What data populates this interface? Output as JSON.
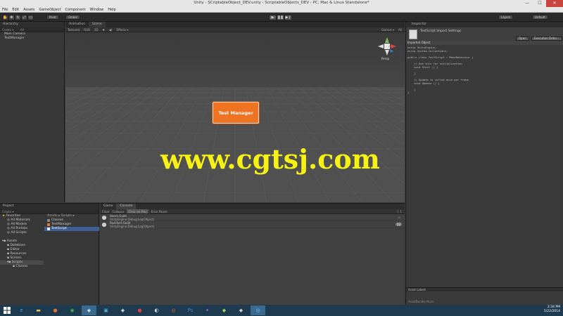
{
  "window": {
    "title": "Unity - SCriptableObject_DEV.unity - ScriptableObjects_DEV - PC, Mac & Linux Standalone*",
    "min": "—",
    "max": "☐",
    "close": "✕"
  },
  "menu": [
    "File",
    "Edit",
    "Assets",
    "GameObject",
    "Component",
    "Window",
    "Help"
  ],
  "toolbar": {
    "pivot": "Pivot",
    "global": "Global",
    "layers": "Layers",
    "layout": "Default"
  },
  "hierarchy": {
    "tab": "Hierarchy",
    "create": "Create ▾",
    "search": "All",
    "items": [
      "Main Camera",
      "TestManager"
    ]
  },
  "scene": {
    "tabs": [
      "Animation",
      "Scene"
    ],
    "bar_items": [
      "Textured",
      "RGB",
      "2D",
      "✹",
      "◀)",
      "Effects ▾"
    ],
    "bar_right": [
      "Gizmos ▾",
      "All"
    ],
    "gizmo_label": "Persp",
    "ui_button": "Test Manager",
    "watermark": "www.cgtsj.com"
  },
  "inspector": {
    "tab": "Inspector",
    "object_name": "TestScript Import Settings",
    "buttons": [
      "Open",
      "Execution Order..."
    ],
    "section": "Imported Object",
    "code": "using UnityEngine;\nusing System.Collections;\n\npublic class TestScript : MonoBehaviour {\n\n    // Use this for initialization\n    void Start () {\n\n    }\n\n    // Update is called once per frame\n    void Update () {\n\n    }\n}",
    "asset_labels": "Asset Labels",
    "assetbundle": "AssetBundle  None"
  },
  "project": {
    "tab": "Project",
    "create": "Create ▾",
    "favorites_header": "Favorites",
    "favorites": [
      "All Materials",
      "All Models",
      "All Prefabs",
      "All Scripts"
    ],
    "assets_header": "Assets",
    "folders": [
      "Database",
      "Editor",
      "Resources",
      "Scenes",
      "Scripts",
      "Classes"
    ],
    "breadcrumb": "Assets ▸ Scripts ▸",
    "files": [
      "Classes",
      "TestManager",
      "TestScript"
    ]
  },
  "console": {
    "tabs": [
      "Game",
      "Console"
    ],
    "bar": [
      "Clear",
      "Collapse",
      "Clear on Play",
      "Error Pause"
    ],
    "badge": "1",
    "logs": [
      {
        "line1": "Storm Guild",
        "line2": "UnityEngine.Debug:Log(Object)",
        "count": ""
      },
      {
        "line1": "Rockford Guild",
        "line2": "UnityEngine.Debug:Log(Object)",
        "count": "12"
      }
    ]
  },
  "taskbar": {
    "time": "2:34 PM",
    "date": "5/22/2014",
    "icons": [
      "ie-icon",
      "explorer-icon",
      "firefox-icon",
      "chrome-icon",
      "unity-icon",
      "media-icon",
      "unity-icon-2",
      "game-icon",
      "app-icon",
      "photoshop-icon",
      "visualstudio-icon",
      "tool-icon",
      "tool-icon-2",
      "web-icon"
    ]
  },
  "colors": {
    "accent_button": "#f07322",
    "watermark": "#f7f214",
    "selection": "#3e5f96"
  }
}
